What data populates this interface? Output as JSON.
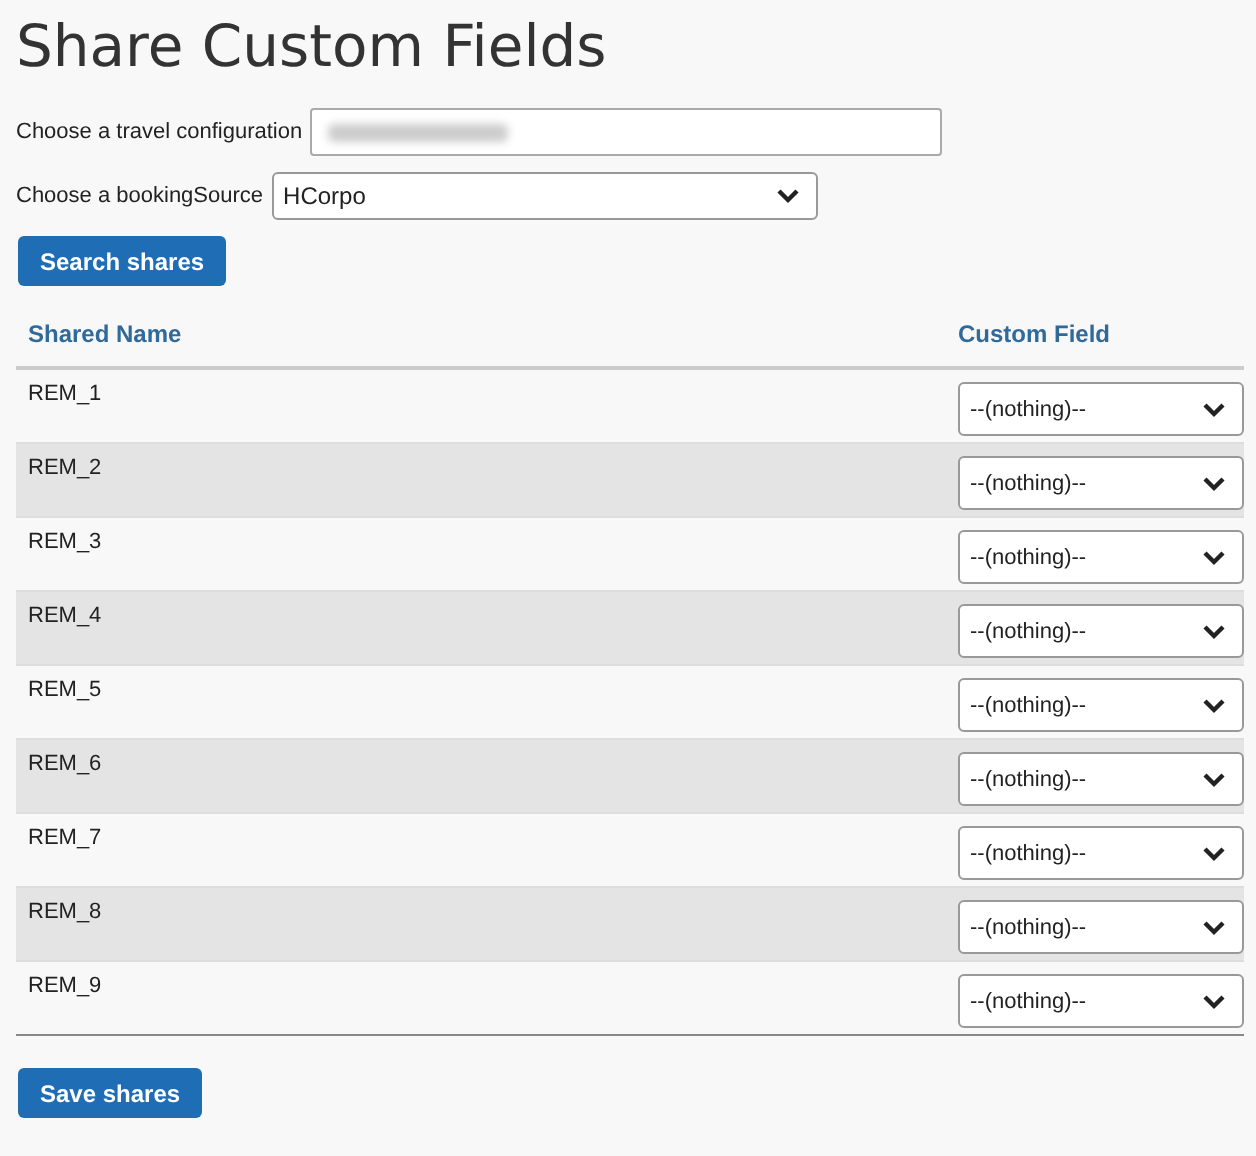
{
  "page": {
    "title": "Share Custom Fields"
  },
  "travel_configuration": {
    "label": "Choose a travel configuration"
  },
  "booking_source": {
    "label": "Choose a bookingSource",
    "value": "HCorpo"
  },
  "search_button": "Search shares",
  "table": {
    "columns": [
      "Shared Name",
      "Custom Field"
    ],
    "rows": [
      {
        "name": "REM_1",
        "custom_field": "--(nothing)--"
      },
      {
        "name": "REM_2",
        "custom_field": "--(nothing)--"
      },
      {
        "name": "REM_3",
        "custom_field": "--(nothing)--"
      },
      {
        "name": "REM_4",
        "custom_field": "--(nothing)--"
      },
      {
        "name": "REM_5",
        "custom_field": "--(nothing)--"
      },
      {
        "name": "REM_6",
        "custom_field": "--(nothing)--"
      },
      {
        "name": "REM_7",
        "custom_field": "--(nothing)--"
      },
      {
        "name": "REM_8",
        "custom_field": "--(nothing)--"
      },
      {
        "name": "REM_9",
        "custom_field": "--(nothing)--"
      }
    ]
  },
  "save_button": "Save shares"
}
